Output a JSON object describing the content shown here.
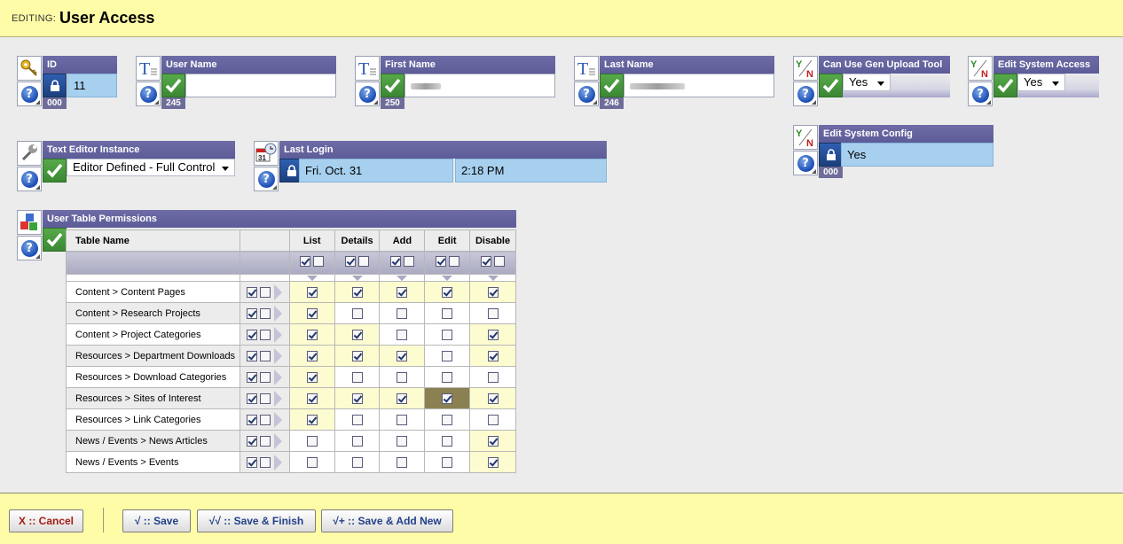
{
  "header": {
    "prefix": "EDITING:",
    "title": "User Access"
  },
  "fields": {
    "id": {
      "label": "ID",
      "value": "11",
      "count": "000"
    },
    "user_name": {
      "label": "User Name",
      "value": "",
      "count": "245"
    },
    "first_name": {
      "label": "First Name",
      "value": "",
      "count": "250"
    },
    "last_name": {
      "label": "Last Name",
      "value": "",
      "count": "246"
    },
    "gen_upload": {
      "label": "Can Use Gen Upload Tool",
      "value": "Yes"
    },
    "edit_sys_access": {
      "label": "Edit System Access",
      "value": "Yes"
    },
    "text_editor": {
      "label": "Text Editor Instance",
      "value": "Editor Defined - Full Control"
    },
    "last_login": {
      "label": "Last Login",
      "date": "Fri. Oct. 31",
      "time": "2:18 PM",
      "calendar_day": "31"
    },
    "edit_sys_config": {
      "label": "Edit System Config",
      "value": "Yes",
      "count": "000"
    }
  },
  "permissions": {
    "label": "User Table Permissions",
    "columns": [
      "Table Name",
      "List",
      "Details",
      "Add",
      "Edit",
      "Disable"
    ],
    "rows": [
      {
        "name": "Content > Content Pages",
        "list": true,
        "details": true,
        "add": true,
        "edit": true,
        "disable": true
      },
      {
        "name": "Content > Research Projects",
        "list": true,
        "details": false,
        "add": false,
        "edit": false,
        "disable": false
      },
      {
        "name": "Content > Project Categories",
        "list": true,
        "details": true,
        "add": false,
        "edit": false,
        "disable": true
      },
      {
        "name": "Resources > Department Downloads",
        "list": true,
        "details": true,
        "add": true,
        "edit": false,
        "disable": true
      },
      {
        "name": "Resources > Download Categories",
        "list": true,
        "details": false,
        "add": false,
        "edit": false,
        "disable": false
      },
      {
        "name": "Resources > Sites of Interest",
        "list": true,
        "details": true,
        "add": true,
        "edit": true,
        "disable": true
      },
      {
        "name": "Resources > Link Categories",
        "list": true,
        "details": false,
        "add": false,
        "edit": false,
        "disable": false
      },
      {
        "name": "News / Events > News Articles",
        "list": false,
        "details": false,
        "add": false,
        "edit": false,
        "disable": true
      },
      {
        "name": "News / Events > Events",
        "list": false,
        "details": false,
        "add": false,
        "edit": false,
        "disable": true
      }
    ]
  },
  "footer": {
    "cancel": "X :: Cancel",
    "save": "√ :: Save",
    "save_finish": "√√ :: Save & Finish",
    "save_add_new": "√+ :: Save & Add New"
  },
  "icons": {
    "id": "key-icon",
    "text": "text-field-icon",
    "yesno": "yes-no-icon",
    "editor": "wrench-icon",
    "login": "calendar-clock-icon",
    "permissions": "table-blocks-icon",
    "help": "help-icon",
    "check": "check-icon",
    "lock": "lock-icon"
  },
  "colors": {
    "header_bg": "#fffca8",
    "label_bg": "#5d5c98",
    "readonly_bg": "#a7d0ef",
    "check_green": "#3b8733"
  }
}
